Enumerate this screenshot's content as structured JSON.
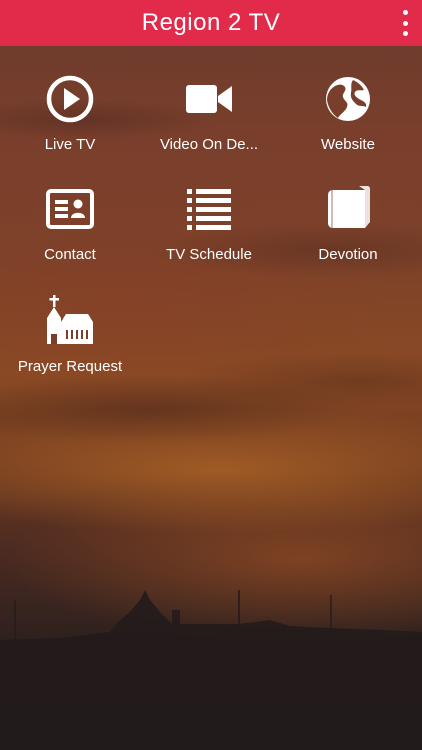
{
  "header": {
    "title": "Region 2 TV",
    "menu_icon": "more-vertical-icon",
    "background_color": "#e22a4b"
  },
  "tiles": [
    {
      "label": "Live TV",
      "icon": "play-circle-icon"
    },
    {
      "label": "Video On De...",
      "icon": "video-camera-icon"
    },
    {
      "label": "Website",
      "icon": "globe-icon"
    },
    {
      "label": "Contact",
      "icon": "contact-card-icon"
    },
    {
      "label": "TV Schedule",
      "icon": "list-icon"
    },
    {
      "label": "Devotion",
      "icon": "book-icon"
    },
    {
      "label": "Prayer Request",
      "icon": "church-icon"
    }
  ]
}
